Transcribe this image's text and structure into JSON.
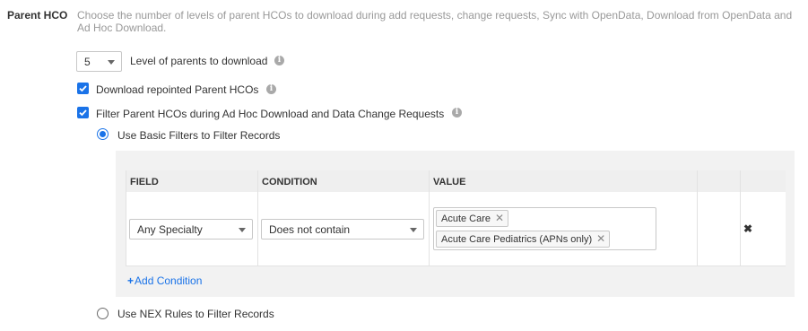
{
  "section": {
    "label": "Parent HCO",
    "description": "Choose the number of levels of parent HCOs to download during add requests, change requests, Sync with OpenData, Download from OpenData and Ad Hoc Download."
  },
  "levels": {
    "selected": "5",
    "label": "Level of parents to download"
  },
  "repointed": {
    "checked": true,
    "label": "Download repointed Parent HCOs"
  },
  "filter_parents": {
    "checked": true,
    "label": "Filter Parent HCOs during Ad Hoc Download and Data Change Requests"
  },
  "radio_basic": {
    "selected": true,
    "label": "Use Basic Filters to Filter Records"
  },
  "radio_nex": {
    "selected": false,
    "label": "Use NEX Rules to Filter Records"
  },
  "table": {
    "headers": {
      "field": "FIELD",
      "condition": "CONDITION",
      "value": "VALUE"
    },
    "row": {
      "field": "Any Specialty",
      "condition": "Does not contain",
      "values": [
        "Acute Care",
        "Acute Care Pediatrics (APNs only)"
      ]
    }
  },
  "add_condition": {
    "label": "Add Condition"
  },
  "icons": {
    "info": "info-icon",
    "remove": "close-icon",
    "chip_remove": "x-icon",
    "add": "plus-icon"
  },
  "colors": {
    "accent": "#1a73e8",
    "description": "#999999"
  }
}
